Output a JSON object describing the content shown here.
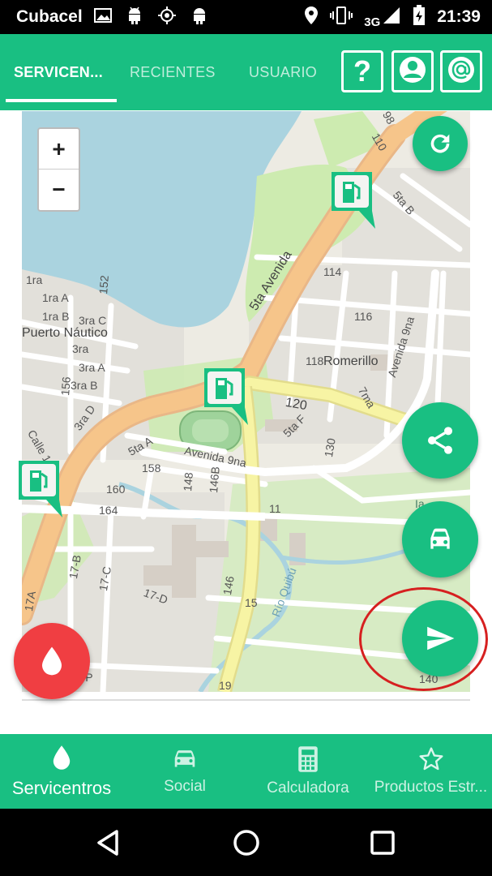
{
  "status_bar": {
    "carrier": "Cubacel",
    "network": "3G",
    "time": "21:39",
    "left_icons": [
      "image-icon",
      "android-icon",
      "gps-icon",
      "android-icon"
    ],
    "right_icons": [
      "location-icon",
      "vibrate-icon",
      "signal-icon",
      "battery-charging-icon"
    ]
  },
  "app_bar": {
    "tabs": [
      {
        "label": "SERVICEN...",
        "active": true
      },
      {
        "label": "RECIENTES",
        "active": false
      },
      {
        "label": "USUARIO",
        "active": false
      }
    ],
    "help_button": "?",
    "actions": [
      "help-icon",
      "account-icon",
      "at-sign-icon"
    ]
  },
  "map": {
    "zoom_in": "+",
    "zoom_out": "−",
    "labels": {
      "puerto_nautico": "Puerto Náutico",
      "sta_avenida": "5ta Avenida",
      "romerillo": "Romerillo",
      "avenida_9na_right": "Avenida 9na",
      "avenida_9na_left": "Avenida 9na",
      "rio_quibu": "Río Quibú",
      "st_120": "120",
      "st_114": "114",
      "st_116": "116",
      "st_118": "118",
      "st_164": "164",
      "st_160": "160",
      "st_158": "158",
      "st_146": "146",
      "st_146b": "146B",
      "st_148": "148",
      "st_152": "152",
      "st_156": "156",
      "st_110": "110",
      "st_98": "98",
      "st_130": "130",
      "st_11": "11",
      "st_15": "15",
      "st_17d": "17-D",
      "st_17c": "17-C",
      "st_17b": "17-B",
      "st_19": "19",
      "st_3ra": "3ra",
      "st_3raa": "3ra A",
      "st_3rab": "3ra B",
      "st_3rac": "3ra C",
      "st_3rad": "3ra D",
      "st_1ra": "1ra",
      "st_1raa": "1ra A",
      "st_1rab": "1ra B",
      "st_5tab": "5ta B",
      "st_5taa": "5ta A",
      "st_5taf": "5ta F",
      "st_7ma": "7ma",
      "st_19p": "19-P",
      "st_17a": "17A",
      "st_calle1": "Calle 1",
      "st_140": "140",
      "st_ia": "Ia"
    }
  },
  "fabs": {
    "refresh": "refresh-icon",
    "share": "share-icon",
    "car": "car-icon",
    "send": "send-icon",
    "drop": "drop-icon"
  },
  "bottom_nav": {
    "items": [
      {
        "label": "Servicentros",
        "icon": "drop-icon",
        "active": true
      },
      {
        "label": "Social",
        "icon": "car-icon",
        "active": false
      },
      {
        "label": "Calculadora",
        "icon": "calculator-icon",
        "active": false
      },
      {
        "label": "Productos Estr...",
        "icon": "star-icon",
        "active": false
      }
    ]
  },
  "colors": {
    "primary": "#19BF82",
    "accent_red": "#F03E42",
    "highlight_circle": "#D62020",
    "road_orange": "#F6C58A",
    "road_yellow": "#F7F4A4",
    "water": "#AAD3DF",
    "park": "#CDEBB0"
  }
}
